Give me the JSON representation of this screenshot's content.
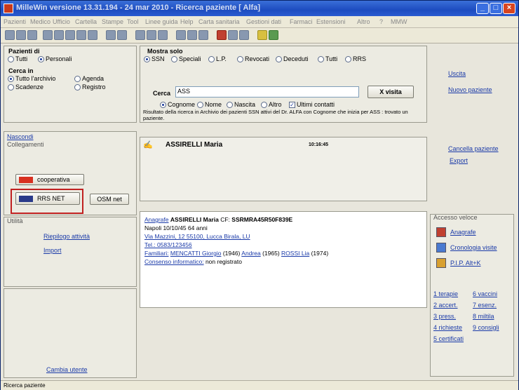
{
  "window": {
    "title": "MilleWin versione 13.31.194 - 24 mar 2010 - Ricerca paziente [ Alfa]",
    "minimize": "_",
    "maximize": "□",
    "close": "×"
  },
  "menu": [
    "Pazienti",
    "Medico",
    "Ufficio",
    "Cartella",
    "Stampe",
    "Tool",
    "Linee guida",
    "Help",
    "Carta sanitaria",
    "Gestioni dati",
    "Farmaci",
    "Estensioni",
    "Altro",
    "?",
    "MMW"
  ],
  "filters": {
    "pazienti_di": {
      "title": "Pazienti di",
      "options": [
        "Tutti",
        "Personali"
      ],
      "selected": 1
    },
    "cerca_in": {
      "title": "Cerca in",
      "options": [
        "Tutto l'archivio",
        "Agenda",
        "Scadenze",
        "Registro"
      ],
      "selected": 0
    },
    "mostra_solo": {
      "title": "Mostra solo",
      "options": [
        "SSN",
        "Speciali",
        "L.P.",
        "Revocati",
        "Deceduti",
        "Tutti",
        "RRS"
      ],
      "selected": 0
    }
  },
  "search": {
    "label": "Cerca",
    "value": "ASS",
    "button": "X visita",
    "options": [
      "Cognome",
      "Nome",
      "Nascita",
      "Altro"
    ],
    "selected": 0,
    "checkbox_label": "Ultimi contatti",
    "checkbox_checked": true,
    "result_text": "Risultato della ricerca in Archivio dei pazienti SSN attivi del Dr. ALFA con Cognome che inizia per ASS : trovato un paziente."
  },
  "left_panel": {
    "nascondi": "Nascondi",
    "collegamenti": "Collegamenti",
    "cooperativa": "cooperativa",
    "rrs_net": "RRS NET",
    "osm_net": "OSM net",
    "utilita": "Utilità",
    "riepilogo": "Riepilogo attività",
    "import": "Import",
    "cambia_utente": "Cambia utente"
  },
  "patient_list": [
    {
      "name": "ASSIRELLI Maria",
      "time": "10:16:45"
    }
  ],
  "patient_detail": {
    "anagrafe_link": "Anagrafe",
    "name": "ASSIRELLI Maria",
    "cf_label": "CF:",
    "cf": "SSRMRA45R50F839E",
    "birth": "Napoli 10/10/45 64 anni",
    "address": "Via Mazzini, 12 55100, Lucca Birala, LU",
    "tel": "Tel.: 0583/123456",
    "familiari_label": "Familiari:",
    "familiari": [
      {
        "name": "MENCATTI Giorgio",
        "year": "(1946)"
      },
      {
        "name": "Andrea",
        "year": "(1965)"
      },
      {
        "name": "ROSSI Lia",
        "year": "(1974)"
      }
    ],
    "consenso_label": "Consenso informatico:",
    "consenso": "non registrato"
  },
  "right_links": {
    "uscita": "Uscita",
    "nuovo_paziente": "Nuovo paziente",
    "cancella": "Cancella paziente",
    "export": "Export"
  },
  "accesso_veloce": {
    "title": "Accesso veloce",
    "items": [
      "Anagrafe",
      "Cronologia visite",
      "P.I.P. Alt+K"
    ],
    "shortcuts": [
      [
        "1 terapie",
        "6 vaccini"
      ],
      [
        "2 accert.",
        "7 esenz."
      ],
      [
        "3 press.",
        "8 miltila"
      ],
      [
        "4 richieste",
        "9 consigli"
      ],
      [
        "5 certificati",
        ""
      ]
    ]
  },
  "status": {
    "text": "Ricerca paziente"
  },
  "colors": {
    "titlebar": "#1d4cc0",
    "link": "#1a3aa8",
    "highlight_border": "#c02020"
  }
}
